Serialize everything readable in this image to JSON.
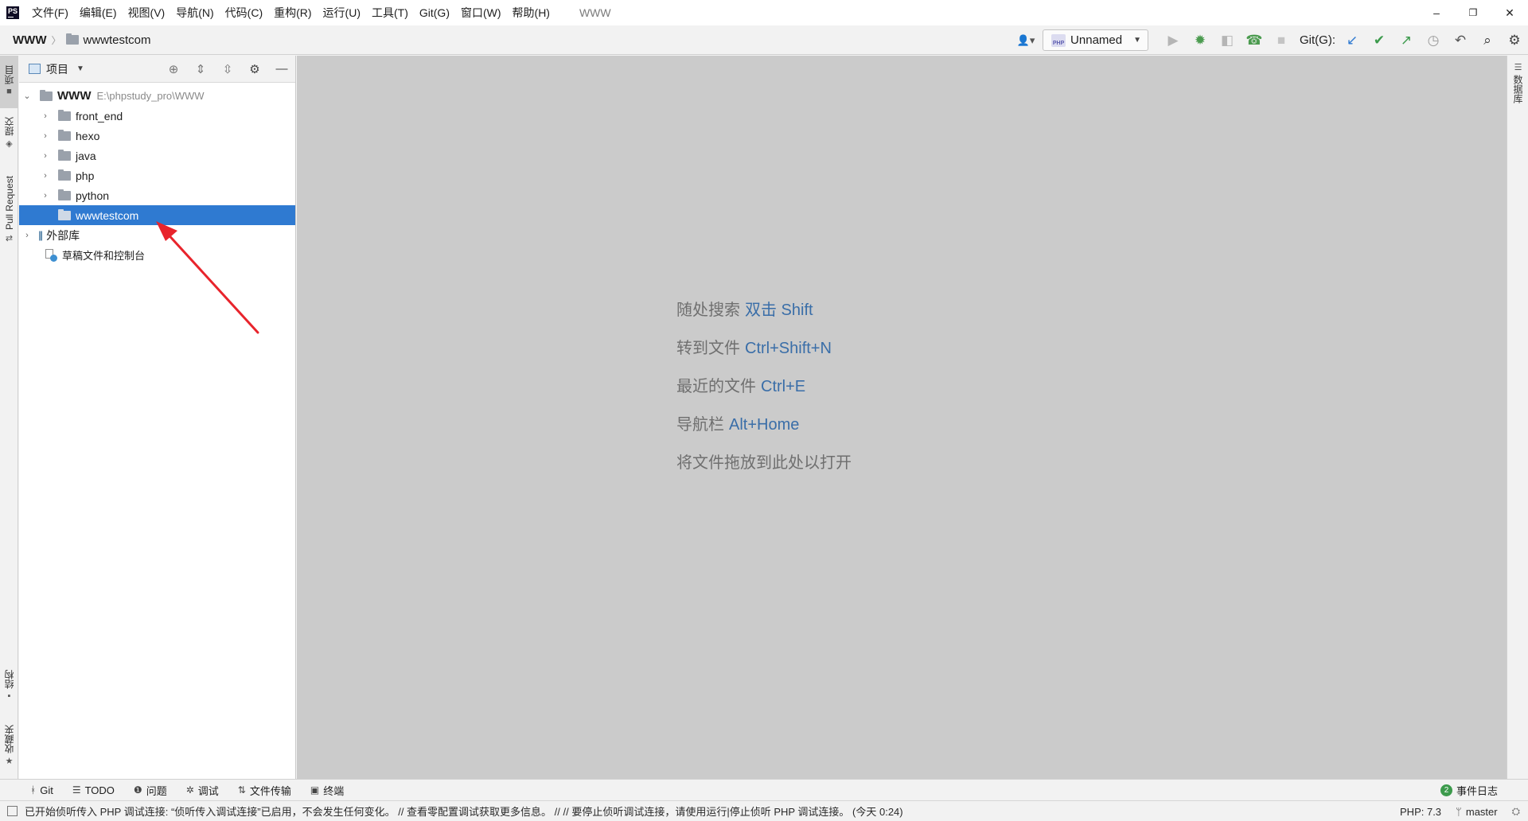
{
  "app": {
    "logo_text": "PS",
    "window_title": "WWW"
  },
  "menu": [
    {
      "label": "文件(F)"
    },
    {
      "label": "编辑(E)"
    },
    {
      "label": "视图(V)"
    },
    {
      "label": "导航(N)"
    },
    {
      "label": "代码(C)"
    },
    {
      "label": "重构(R)"
    },
    {
      "label": "运行(U)"
    },
    {
      "label": "工具(T)"
    },
    {
      "label": "Git(G)"
    },
    {
      "label": "窗口(W)"
    },
    {
      "label": "帮助(H)"
    }
  ],
  "window_controls": {
    "minimize": "–",
    "restore": "❐",
    "close": "✕"
  },
  "breadcrumb": {
    "root": "WWW",
    "sep": "〉",
    "leaf": "wwwtestcom"
  },
  "toolbar": {
    "user_icon": "👤▾",
    "run_config": "Unnamed",
    "run_config_badge": "PHP",
    "git_label": "Git(G):"
  },
  "left_stripe": {
    "project": "项目",
    "commit": "提交",
    "pull_requests": "Pull Request",
    "structure": "结构",
    "favorites": "收藏夹"
  },
  "right_stripe": {
    "database": "数据库"
  },
  "project_panel": {
    "title": "项目",
    "root": {
      "name": "WWW",
      "path": "E:\\phpstudy_pro\\WWW"
    },
    "folders": [
      "front_end",
      "hexo",
      "java",
      "php",
      "python",
      "wwwtestcom"
    ],
    "selected": "wwwtestcom",
    "external_libs": "外部库",
    "scratches": "草稿文件和控制台"
  },
  "editor_hints": [
    {
      "text": "随处搜索",
      "key": "双击 Shift"
    },
    {
      "text": "转到文件",
      "key": "Ctrl+Shift+N"
    },
    {
      "text": "最近的文件",
      "key": "Ctrl+E"
    },
    {
      "text": "导航栏",
      "key": "Alt+Home"
    },
    {
      "text": "将文件拖放到此处以打开",
      "key": ""
    }
  ],
  "tool_windows": [
    {
      "icon": "ᚼ",
      "label": "Git"
    },
    {
      "icon": "☰",
      "label": "TODO"
    },
    {
      "icon": "❶",
      "label": "问题"
    },
    {
      "icon": "✲",
      "label": "调试"
    },
    {
      "icon": "⇅",
      "label": "文件传输"
    },
    {
      "icon": "▣",
      "label": "终端"
    }
  ],
  "event_log": {
    "count": "2",
    "label": "事件日志"
  },
  "status": {
    "message": "已开始侦听传入 PHP 调试连接: “侦听传入调试连接”已启用，不会发生任何变化。 // 查看零配置调试获取更多信息。 // // 要停止侦听调试连接，请使用运行|停止侦听 PHP 调试连接。 (今天 0:24)",
    "php_version": "PHP: 7.3",
    "branch": "master"
  },
  "colors": {
    "selection": "#2f7ad1",
    "hint_key": "#3a6ea8",
    "annotation_arrow": "#e8242c"
  }
}
